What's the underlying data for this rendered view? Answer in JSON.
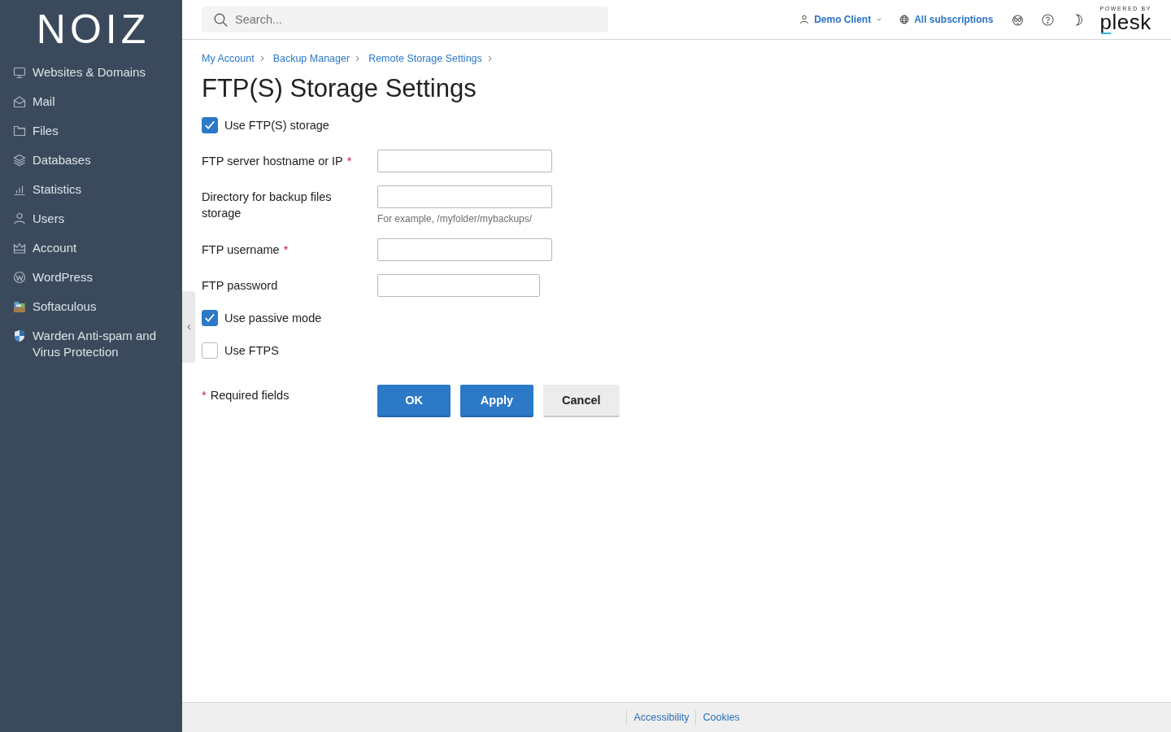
{
  "sidebar": {
    "logo": "NOIZ",
    "items": [
      {
        "label": "Websites & Domains",
        "selected": false
      },
      {
        "label": "Mail",
        "selected": false
      },
      {
        "label": "Files",
        "selected": false
      },
      {
        "label": "Databases",
        "selected": false
      },
      {
        "label": "Statistics",
        "selected": false
      },
      {
        "label": "Users",
        "selected": false
      },
      {
        "label": "Account",
        "selected": false
      },
      {
        "label": "WordPress",
        "selected": false
      },
      {
        "label": "Softaculous",
        "selected": false
      },
      {
        "label": "Warden Anti-spam and Virus Protection",
        "selected": false
      }
    ]
  },
  "header": {
    "search": {
      "placeholder": "Search..."
    },
    "user_menu": "Demo Client",
    "subscriptions": "All subscriptions",
    "branding": {
      "caption": "POWERED BY",
      "wordmark": "plesk"
    }
  },
  "breadcrumbs": [
    "My Account",
    "Backup Manager",
    "Remote Storage Settings"
  ],
  "title": "FTP(S) Storage Settings",
  "form": {
    "fields": [
      {
        "kind": "checkbox",
        "label": "Use FTP(S) storage",
        "checked": true
      },
      {
        "kind": "text",
        "label": "FTP server hostname or IP",
        "required_mark": "*"
      },
      {
        "kind": "text",
        "label": "Directory for backup files storage",
        "hint": "For example, /myfolder/mybackups/"
      },
      {
        "kind": "text",
        "label": "FTP username",
        "required_mark": "*"
      },
      {
        "kind": "password",
        "label": "FTP password"
      },
      {
        "kind": "checkbox",
        "label": "Use passive mode",
        "checked": true
      },
      {
        "kind": "checkbox",
        "label": "Use FTPS",
        "checked": false
      }
    ],
    "required_note": {
      "mark": "*",
      "text": "Required fields"
    },
    "buttons": [
      {
        "kind": "primary",
        "label": "OK"
      },
      {
        "kind": "primary",
        "label": "Apply"
      },
      {
        "kind": "secondary",
        "label": "Cancel"
      }
    ]
  },
  "footer": {
    "links": [
      "Accessibility",
      "Cookies"
    ]
  }
}
